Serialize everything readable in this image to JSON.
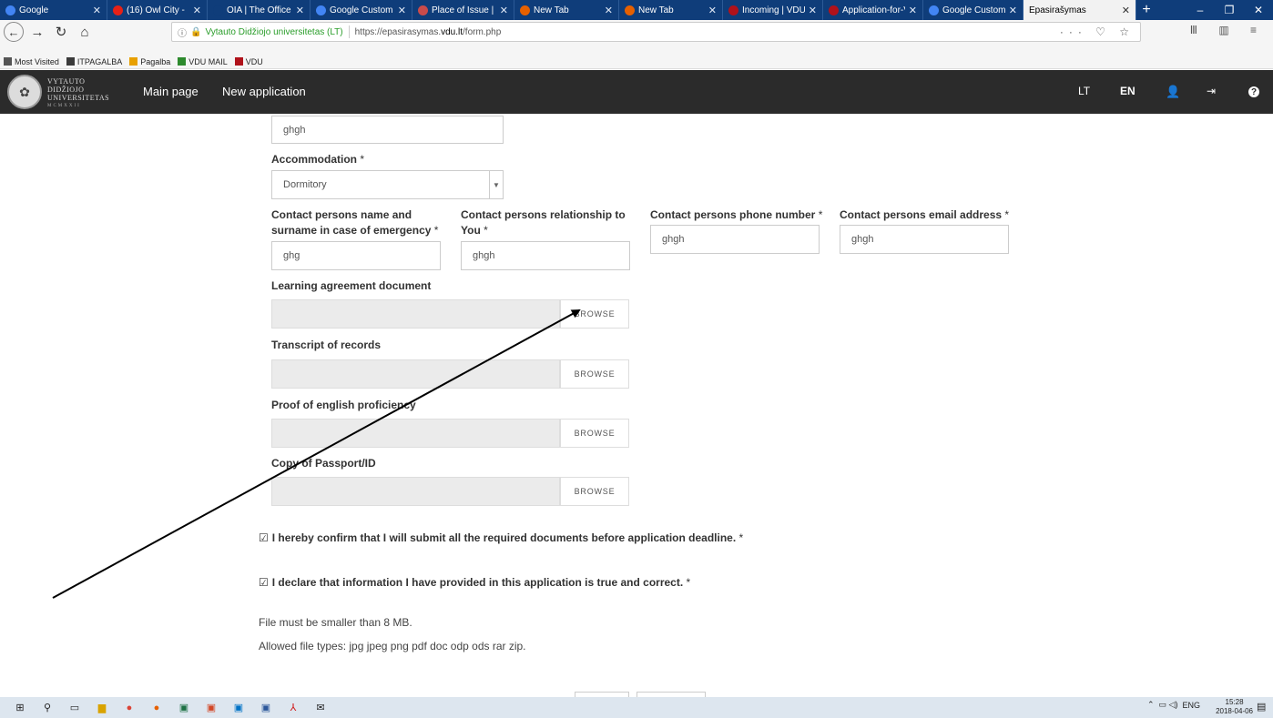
{
  "browser": {
    "tabs": [
      {
        "label": "Google",
        "favicon": "google-icon",
        "color": "#4285f4",
        "active": false
      },
      {
        "label": "(16) Owl City -",
        "favicon": "youtube-icon",
        "color": "#e62117",
        "active": false
      },
      {
        "label": "OIA | The Office of Int",
        "favicon": "page-icon",
        "color": "#0f3d7a",
        "active": false
      },
      {
        "label": "Google Custom Se",
        "favicon": "google-icon",
        "color": "#4285f4",
        "active": false
      },
      {
        "label": "Place of Issue | Vis",
        "favicon": "place-icon",
        "color": "#c94b4b",
        "active": false
      },
      {
        "label": "New Tab",
        "favicon": "firefox-icon",
        "color": "#e66000",
        "active": false
      },
      {
        "label": "New Tab",
        "favicon": "firefox-icon",
        "color": "#e66000",
        "active": false
      },
      {
        "label": "Incoming | VDU",
        "favicon": "vdu-icon",
        "color": "#b0121b",
        "active": false
      },
      {
        "label": "Application-for-V",
        "favicon": "vdu-icon",
        "color": "#b0121b",
        "active": false
      },
      {
        "label": "Google Custom Se",
        "favicon": "google-icon",
        "color": "#4285f4",
        "active": false
      },
      {
        "label": "Epasirašymas",
        "favicon": "",
        "color": "#f2f2f2",
        "active": true
      }
    ],
    "site_identity": "Vytauto Didžiojo universitetas (LT)",
    "url_prefix": "https://epasirasymas.",
    "url_domain": "vdu.lt",
    "url_path": "/form.php",
    "bookmarks": [
      {
        "label": "Most Visited",
        "icon": "gear-icon"
      },
      {
        "label": "ITPAGALBA",
        "icon": "g-icon"
      },
      {
        "label": "Pagalba",
        "icon": "heart-icon"
      },
      {
        "label": "VDU MAIL",
        "icon": "windows-icon"
      },
      {
        "label": "VDU",
        "icon": "vdu-icon"
      }
    ]
  },
  "site": {
    "logo_line1": "VYTAUTO",
    "logo_line2": "DIDŽIOJO",
    "logo_line3": "UNIVERSITETAS",
    "logo_line4": "MCMXXII",
    "nav": [
      {
        "label": "Main page"
      },
      {
        "label": "New application"
      }
    ],
    "lang_lt": "LT",
    "lang_en": "EN"
  },
  "form": {
    "top_field_value": "ghgh",
    "accommodation_label": "Accommodation",
    "accommodation_value": "Dormitory",
    "contact_name_label": "Contact persons name and surname in case of emergency",
    "contact_name_value": "ghg",
    "contact_rel_label": "Contact persons relationship to You",
    "contact_rel_value": "ghgh",
    "contact_phone_label": "Contact persons phone number",
    "contact_phone_value": "ghgh",
    "contact_email_label": "Contact persons email address",
    "contact_email_value": "ghgh",
    "required_mark": "*",
    "files": [
      {
        "label": "Learning agreement document",
        "button": "BROWSE"
      },
      {
        "label": "Transcript of records",
        "button": "BROWSE"
      },
      {
        "label": "Proof of english proficiency",
        "button": "BROWSE"
      },
      {
        "label": "Copy of Passport/ID",
        "button": "BROWSE"
      }
    ],
    "confirm1": "I hereby confirm that I will submit all the required documents before application deadline.",
    "confirm2": "I declare that information I have provided in this application is true and correct.",
    "note1": "File must be smaller than 8 MB.",
    "note2": "Allowed file types: jpg jpeg png pdf doc odp ods rar zip."
  },
  "taskbar": {
    "lang": "ENG",
    "time": "15:28",
    "date": "2018-04-06"
  }
}
